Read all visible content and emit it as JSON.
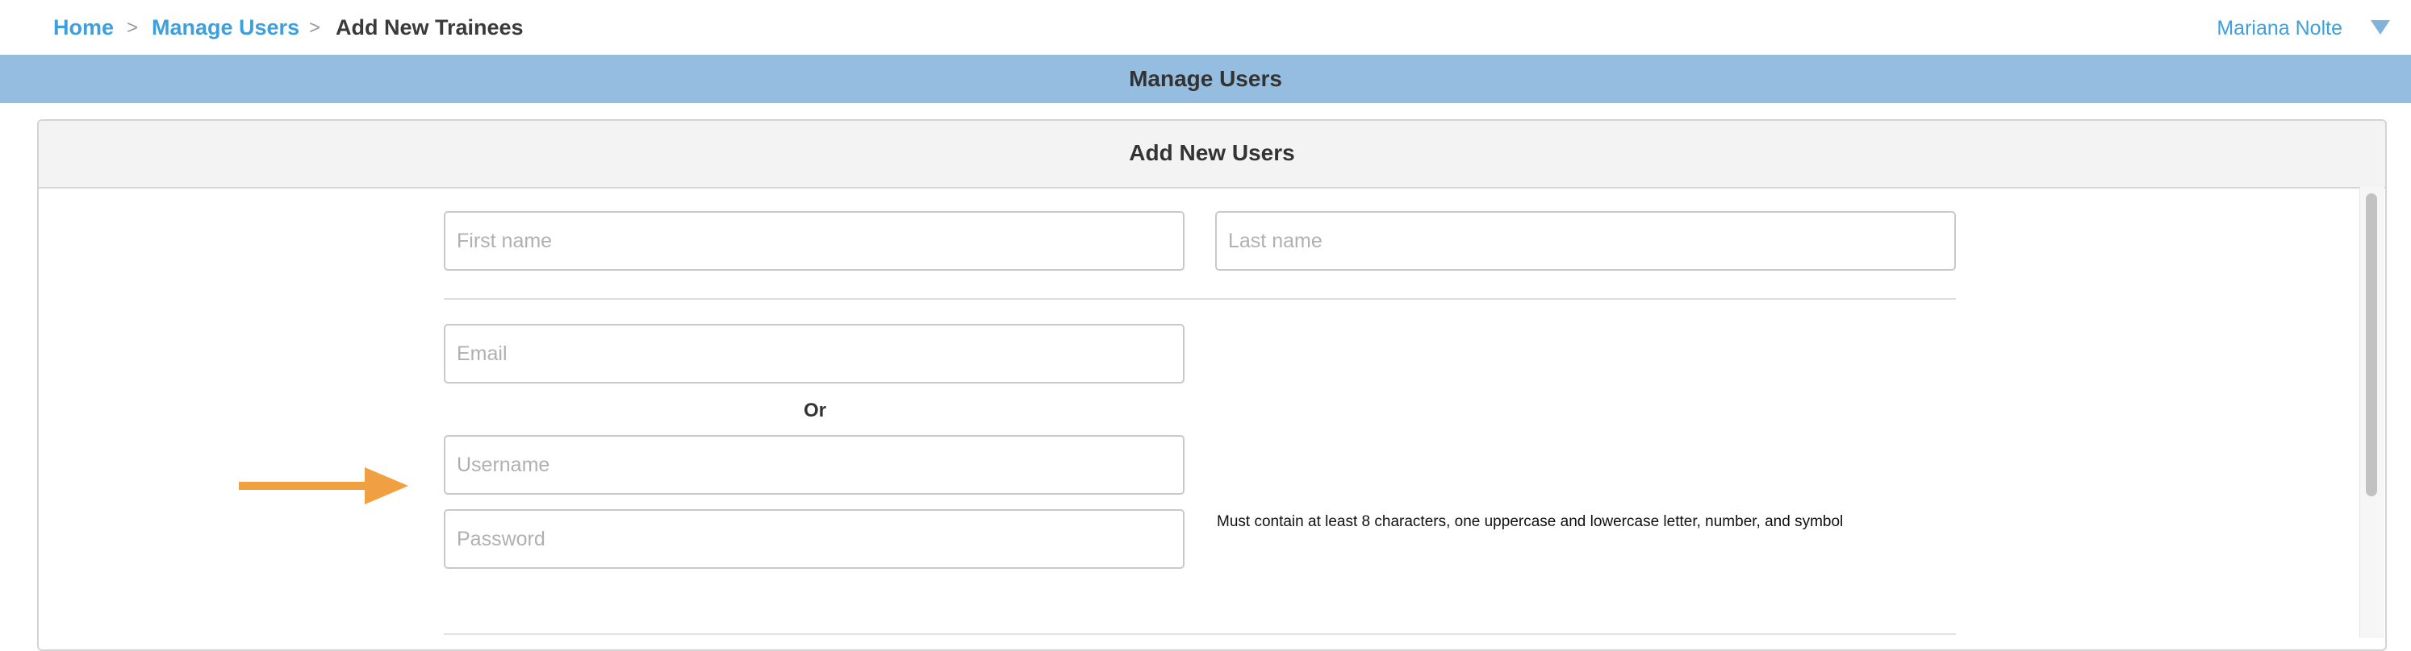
{
  "breadcrumb": {
    "home": "Home",
    "manage_users": "Manage Users",
    "current": "Add New Trainees",
    "separator": ">"
  },
  "user_menu": {
    "name": "Mariana Nolte"
  },
  "header": {
    "title": "Manage Users"
  },
  "panel": {
    "title": "Add New Users",
    "first_name_placeholder": "First name",
    "last_name_placeholder": "Last name",
    "email_placeholder": "Email",
    "or_label": "Or",
    "username_placeholder": "Username",
    "password_placeholder": "Password",
    "password_hint": "Must contain at least 8 characters, one uppercase and lowercase letter, number, and symbol"
  },
  "colors": {
    "link": "#3d9fdc",
    "header_band": "#94bddf",
    "annotation_arrow": "#f0a040"
  },
  "icons": {
    "user_menu": "caret-down-icon",
    "annotation": "arrow-right-icon"
  }
}
